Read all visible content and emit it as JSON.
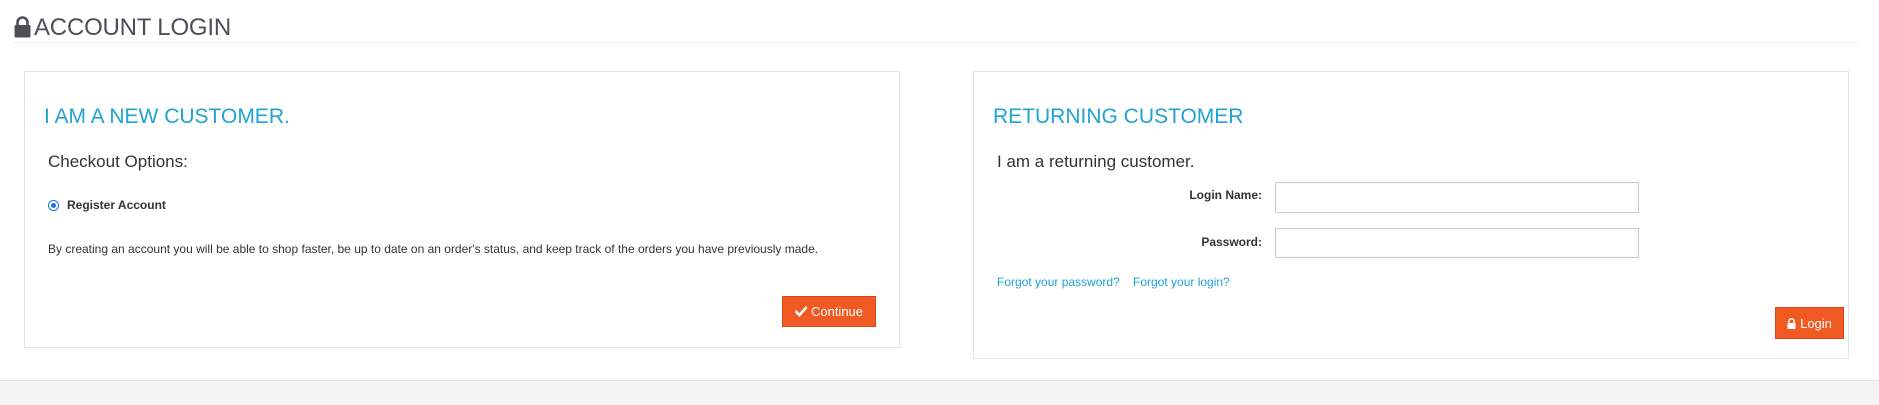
{
  "header": {
    "title": "ACCOUNT LOGIN",
    "icon": "lock-icon"
  },
  "new_customer": {
    "heading": "I AM A NEW CUSTOMER.",
    "checkout_label": "Checkout Options:",
    "option_label": "Register Account",
    "option_selected": true,
    "description": "By creating an account you will be able to shop faster, be up to date on an order's status, and keep track of the orders you have previously made.",
    "continue_label": "Continue",
    "continue_icon": "check-icon"
  },
  "returning_customer": {
    "heading": "RETURNING CUSTOMER",
    "intro": "I am a returning customer.",
    "login_name_label": "Login Name:",
    "login_name_value": "",
    "password_label": "Password:",
    "password_value": "",
    "forgot_password": "Forgot your password?",
    "forgot_login": "Forgot your login?",
    "login_label": "Login",
    "login_icon": "lock-icon"
  },
  "colors": {
    "accent": "#1fa3d3",
    "button": "#f15a22",
    "title": "#4c5055"
  }
}
